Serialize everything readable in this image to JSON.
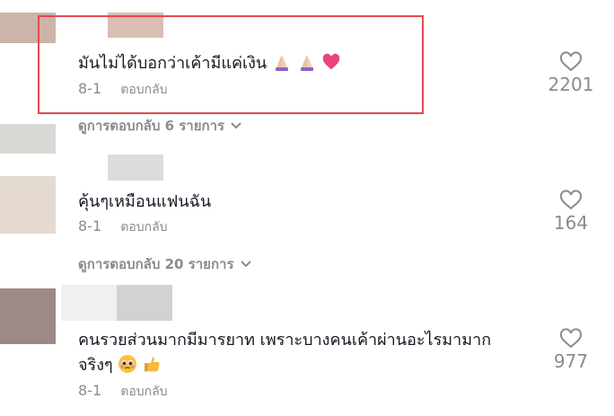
{
  "comments": [
    {
      "text": "มันไม่ได้บอกว่าเค้ามีแค่เงิน",
      "emojis": [
        "folded-hands",
        "folded-hands",
        "pink-heart"
      ],
      "date": "8-1",
      "reply_label": "ตอบกลับ",
      "likes": "2201",
      "view_replies": "ดูการตอบกลับ 6 รายการ"
    },
    {
      "text": "คุ้นๆเหมือนแฟนฉัน",
      "date": "8-1",
      "reply_label": "ตอบกลับ",
      "likes": "164",
      "view_replies": "ดูการตอบกลับ 20 รายการ"
    },
    {
      "text_line1": "คนรวยส่วนมากมีมารยาท เพราะบางคนเค้าผ่านอะไรมามาก",
      "text_line2": "จริงๆ",
      "emojis": [
        "pleading-face",
        "thumbs-up"
      ],
      "date": "8-1",
      "reply_label": "ตอบกลับ",
      "likes": "977"
    }
  ],
  "colors": {
    "highlight": "#e5484d",
    "heart": "#e8457a",
    "text": "#161823",
    "muted": "#8a8b91"
  }
}
